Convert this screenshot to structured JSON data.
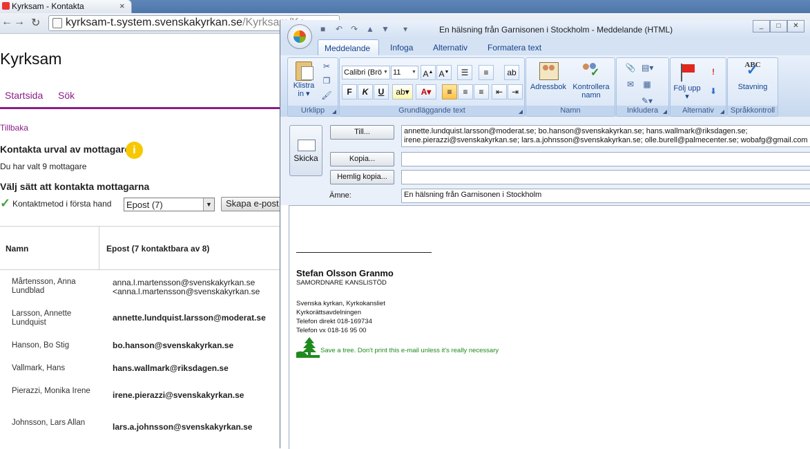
{
  "browser": {
    "tab_title": "Kyrksam - Kontakta",
    "url_host": "kyrksam-t.system.svenskakyrkan.se",
    "url_path": "/Kyrksam/Ko",
    "site_title": "Kyrksam",
    "nav": [
      "Startsida",
      "Sök"
    ],
    "back_link": "Tillbaka",
    "heading_contact": "Kontakta urval av mottagare",
    "selected_text": "Du har valt 9 mottagare",
    "heading_method": "Välj sätt att kontakta mottagarna",
    "firsthand_label": "Kontaktmetod i första hand",
    "method_select_value": "Epost (7)",
    "create_button": "Skapa e-post",
    "table": {
      "col_name": "Namn",
      "col_email": "Epost (7 kontaktbara av 8)",
      "rows": [
        {
          "name": "Mårtensson, Anna Lundblad",
          "email": "anna.l.martensson@svenskakyrkan.se",
          "email2": "<anna.l.martensson@svenskakyrkan.se"
        },
        {
          "name": "Larsson, Annette Lundquist",
          "email": "annette.lundquist.larsson@moderat.se"
        },
        {
          "name": "Hanson, Bo Stig",
          "email": "bo.hanson@svenskakyrkan.se"
        },
        {
          "name": "Vallmark, Hans",
          "email": "hans.wallmark@riksdagen.se"
        },
        {
          "name": "Pierazzi, Monika Irene",
          "email": "irene.pierazzi@svenskakyrkan.se"
        },
        {
          "name": "Johnsson, Lars Allan",
          "email": "lars.a.johnsson@svenskakyrkan.se"
        }
      ]
    }
  },
  "outlook": {
    "window_title": "En hälsning från Garnisonen i Stockholm - Meddelande (HTML)",
    "tabs": [
      "Meddelande",
      "Infoga",
      "Alternativ",
      "Formatera text"
    ],
    "groups": {
      "urklipp": {
        "label": "Urklipp",
        "paste": "Klistra in"
      },
      "text": {
        "label": "Grundläggande text",
        "font": "Calibri (Brö",
        "size": "11"
      },
      "namn": {
        "label": "Namn",
        "adressbok": "Adressbok",
        "kontrollera": "Kontrollera namn"
      },
      "inkludera": {
        "label": "Inkludera"
      },
      "alternativ": {
        "label": "Alternativ",
        "folj": "Följ upp"
      },
      "sprak": {
        "label": "Språkkontroll",
        "stavning": "Stavning",
        "abc": "ABC"
      }
    },
    "send_button": "Skicka",
    "to_button": "Till...",
    "cc_button": "Kopia...",
    "bcc_button": "Hemlig kopia...",
    "subject_label": "Ämne:",
    "to_line1": "annette.lundquist.larsson@moderat.se; bo.hanson@svenskakyrkan.se; hans.wallmark@riksdagen.se;",
    "to_line2": "irene.pierazzi@svenskakyrkan.se; lars.a.johnsson@svenskakyrkan.se; olle.burell@palmecenter.se; wobafg@gmail.com",
    "cc_value": "",
    "bcc_value": "",
    "subject_value": "En hälsning från Garnisonen i Stockholm",
    "signature": {
      "name": "Stefan Olsson Granmo",
      "role": "SAMORDNARE KANSLISTÖD",
      "org": "Svenska kyrkan, Kyrkokansliet",
      "dept": "Kyrkorättsavdelningen",
      "phone_direct": "Telefon direkt  018-169734",
      "phone_vx": "Telefon vx 018-16 95 00",
      "tree_note": "Save a tree. Don't print this e-mail unless it's really necessary"
    }
  },
  "colors": {
    "accent_purple": "#8c1b87",
    "info_yellow": "#f7c800",
    "check_green": "#3ea33e",
    "signature_green": "#1e8a1e"
  }
}
